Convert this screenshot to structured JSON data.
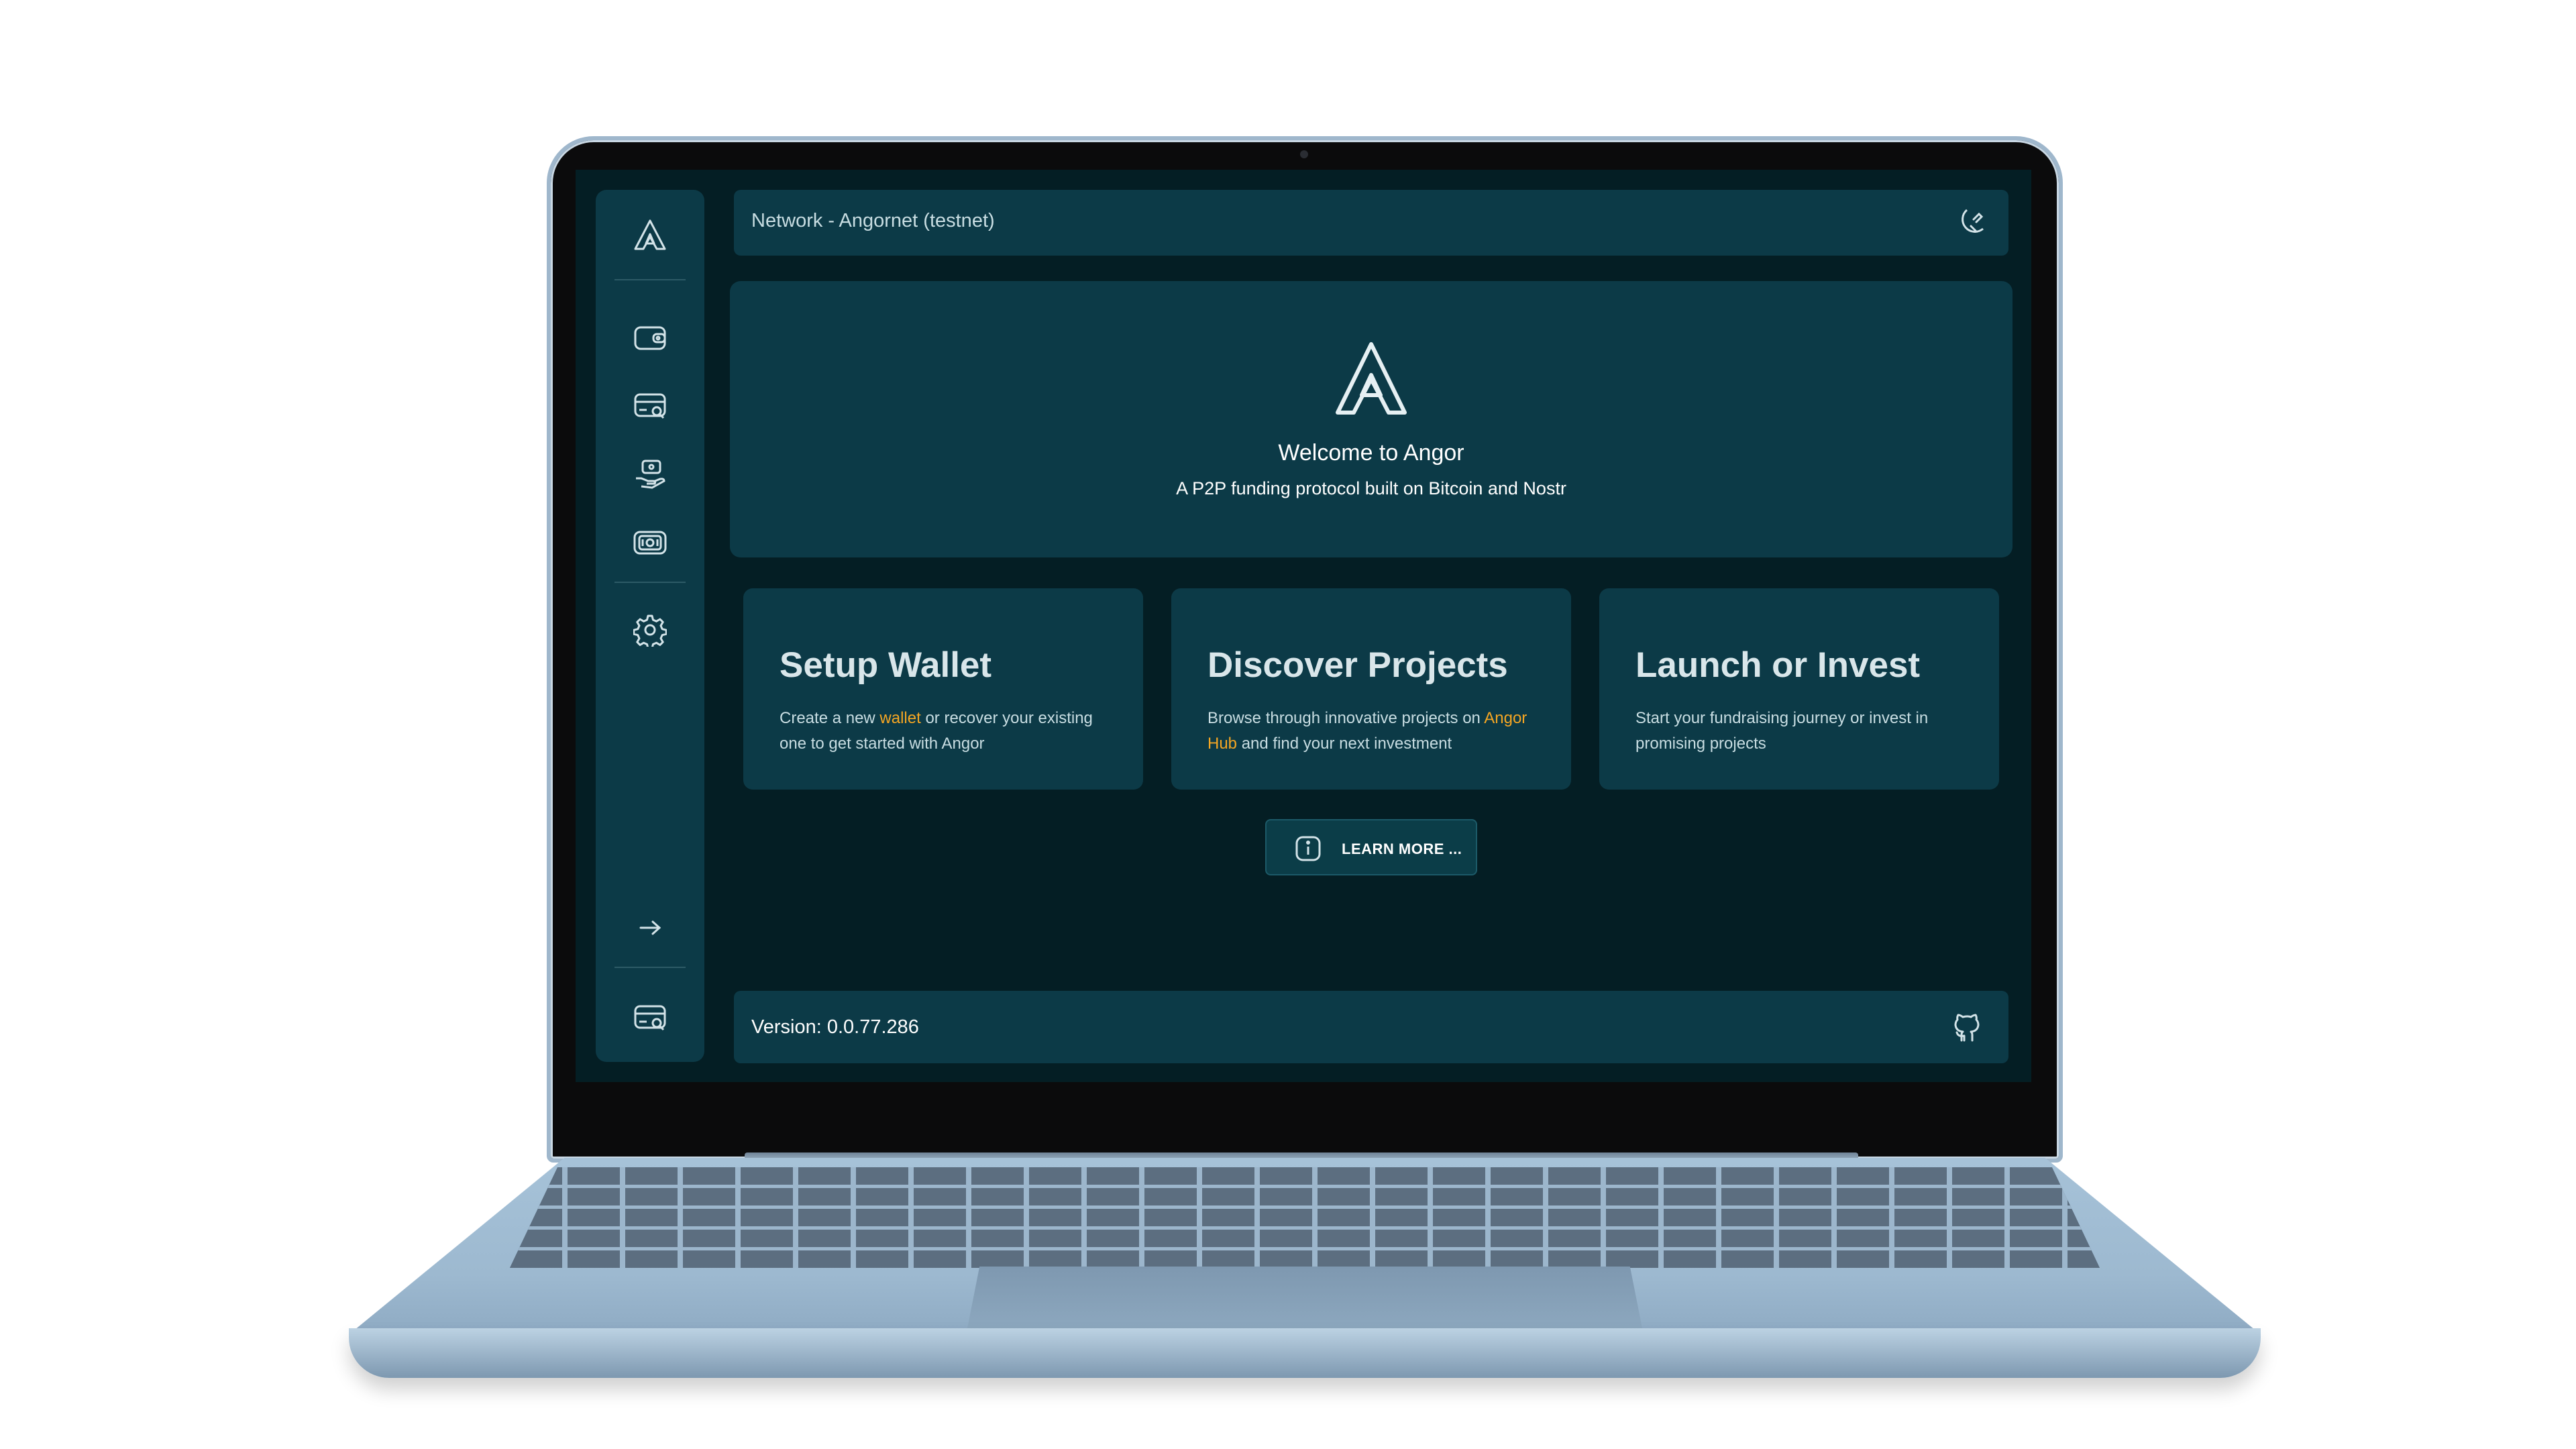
{
  "header": {
    "network_label": "Network - Angornet (testnet)"
  },
  "hero": {
    "title": "Welcome to Angor",
    "subtitle": "A P2P funding protocol built on Bitcoin and Nostr"
  },
  "cards": [
    {
      "title": "Setup Wallet",
      "desc_before": "Create a new ",
      "desc_link": "wallet",
      "desc_after": " or recover your existing one to get started with Angor"
    },
    {
      "title": "Discover Projects",
      "desc_before": "Browse through innovative projects on ",
      "desc_link": "Angor Hub",
      "desc_after": " and find your next investment"
    },
    {
      "title": "Launch or Invest",
      "desc_before": "Start your fundraising journey or invest in promising projects",
      "desc_link": "",
      "desc_after": ""
    }
  ],
  "learn_more": {
    "label": "LEARN MORE ..."
  },
  "footer": {
    "version": "Version: 0.0.77.286"
  },
  "icons": {
    "sidebar": [
      "angor-logo-icon",
      "wallet-icon",
      "browse-icon",
      "invest-icon",
      "funds-icon",
      "gear-icon",
      "arrow-right-icon",
      "browse-icon"
    ],
    "header": "theme-toggle-icon",
    "footer": "github-icon"
  },
  "colors": {
    "background": "#041e24",
    "panel": "#0c3a47",
    "accent": "#f5a623",
    "text": "#ffffff"
  }
}
